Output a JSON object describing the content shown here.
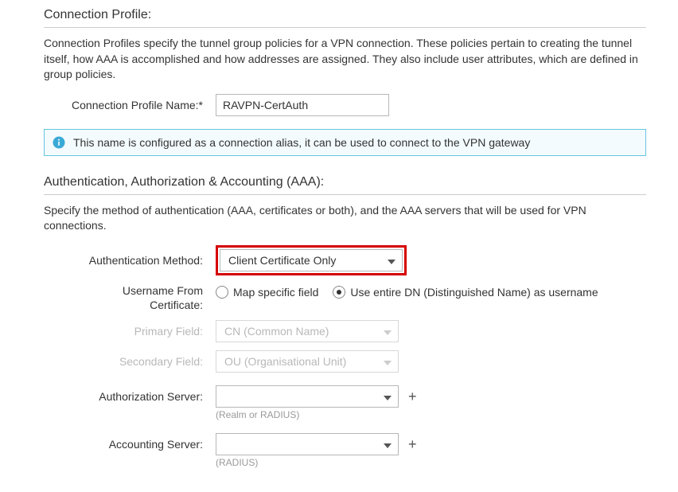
{
  "section1": {
    "title": "Connection Profile:",
    "desc": "Connection Profiles specify the tunnel group policies for a VPN connection. These policies pertain to creating the tunnel itself, how AAA is accomplished and how addresses are assigned. They also include user attributes, which are defined in group policies.",
    "profile_name_label": "Connection Profile Name:*",
    "profile_name_value": "RAVPN-CertAuth",
    "info_text": "This name is configured as a connection alias, it can be used to connect to the VPN gateway"
  },
  "section2": {
    "title": "Authentication, Authorization & Accounting (AAA):",
    "desc": "Specify the method of authentication (AAA, certificates or both), and the AAA servers that will be used for VPN connections.",
    "auth_method_label": "Authentication Method:",
    "auth_method_value": "Client Certificate Only",
    "username_from_cert_label_l1": "Username From",
    "username_from_cert_label_l2": "Certificate:",
    "radio_map": "Map specific field",
    "radio_dn": "Use entire DN (Distinguished Name) as username",
    "primary_field_label": "Primary Field:",
    "primary_field_value": "CN (Common Name)",
    "secondary_field_label": "Secondary Field:",
    "secondary_field_value": "OU (Organisational Unit)",
    "authorization_server_label": "Authorization Server:",
    "authorization_server_hint": "(Realm or RADIUS)",
    "accounting_server_label": "Accounting Server:",
    "accounting_server_hint": "(RADIUS)"
  }
}
